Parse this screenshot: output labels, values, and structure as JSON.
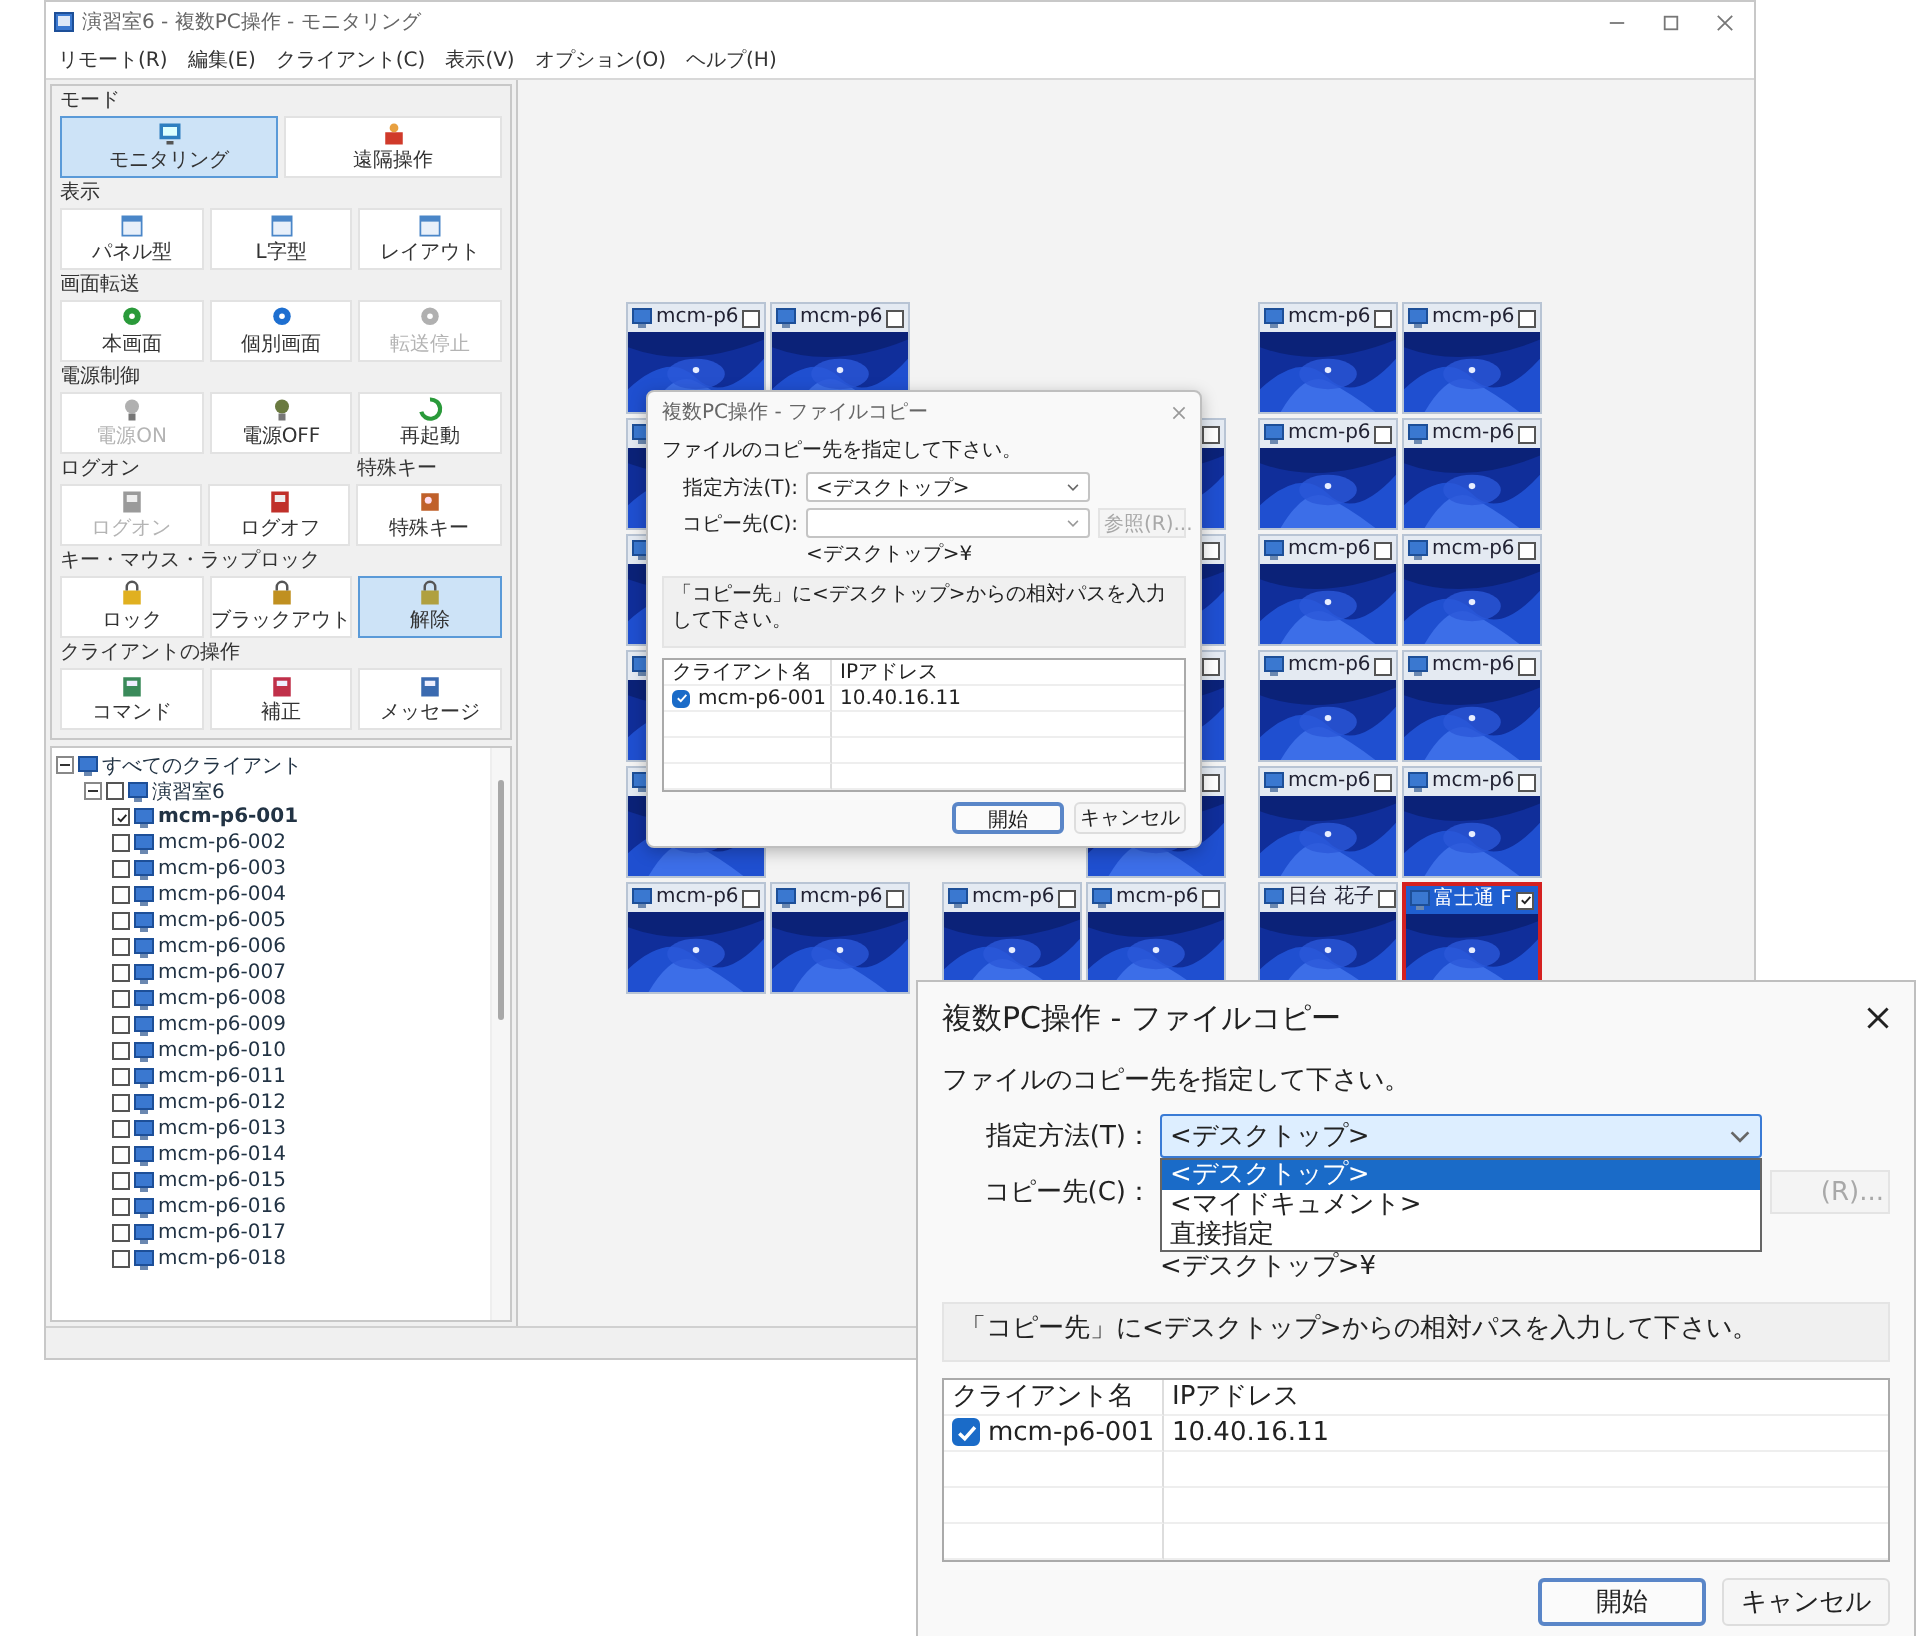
{
  "window": {
    "title": "演習室6 - 複数PC操作 - モニタリング"
  },
  "menu": [
    "リモート(R)",
    "編集(E)",
    "クライアント(C)",
    "表示(V)",
    "オプション(O)",
    "ヘルプ(H)"
  ],
  "toolbox": [
    {
      "groups": [
        {
          "title": "モード",
          "buttons": [
            {
              "label": "モニタリング",
              "kind": "monitor",
              "color": "#2f7fc0",
              "selected": true,
              "disabled": false
            },
            {
              "label": "遠隔操作",
              "kind": "person",
              "color": "#d03a2a",
              "selected": false,
              "disabled": false
            }
          ]
        }
      ]
    },
    {
      "groups": [
        {
          "title": "表示",
          "buttons": [
            {
              "label": "パネル型",
              "kind": "window",
              "color": "#4a86c8",
              "selected": false,
              "disabled": false
            },
            {
              "label": "L字型",
              "kind": "window",
              "color": "#4a86c8",
              "selected": false,
              "disabled": false
            },
            {
              "label": "レイアウト",
              "kind": "window",
              "color": "#4a86c8",
              "selected": false,
              "disabled": false
            }
          ]
        }
      ]
    },
    {
      "groups": [
        {
          "title": "画面転送",
          "buttons": [
            {
              "label": "本画面",
              "kind": "dot",
              "color": "#2a9a3a",
              "selected": false,
              "disabled": false
            },
            {
              "label": "個別画面",
              "kind": "dot",
              "color": "#1e6fd0",
              "selected": false,
              "disabled": false
            },
            {
              "label": "転送停止",
              "kind": "dot",
              "color": "#b0b0b0",
              "selected": false,
              "disabled": true
            }
          ]
        }
      ]
    },
    {
      "groups": [
        {
          "title": "電源制御",
          "buttons": [
            {
              "label": "電源ON",
              "kind": "bulb",
              "color": "#b0b0b0",
              "selected": false,
              "disabled": true
            },
            {
              "label": "電源OFF",
              "kind": "bulb",
              "color": "#6a7a40",
              "selected": false,
              "disabled": false
            },
            {
              "label": "再起動",
              "kind": "cycle",
              "color": "#2a9a3a",
              "selected": false,
              "disabled": false
            }
          ]
        }
      ]
    },
    {
      "groups": [
        {
          "title": "ログオン",
          "buttons": [
            {
              "label": "ログオン",
              "kind": "user",
              "color": "#9a9a9a",
              "selected": false,
              "disabled": true
            },
            {
              "label": "ログオフ",
              "kind": "user",
              "color": "#c0302a",
              "selected": false,
              "disabled": false
            }
          ]
        },
        {
          "title": "特殊キー",
          "buttons": [
            {
              "label": "特殊キー",
              "kind": "key",
              "color": "#c0602a",
              "selected": false,
              "disabled": false
            }
          ]
        }
      ]
    },
    {
      "groups": [
        {
          "title": "キー・マウス・ラップロック",
          "buttons": [
            {
              "label": "ロック",
              "kind": "lock",
              "color": "#e0b020",
              "selected": false,
              "disabled": false
            },
            {
              "label": "ブラックアウト",
              "kind": "lock",
              "color": "#c09020",
              "selected": false,
              "disabled": false
            },
            {
              "label": "解除",
              "kind": "lock",
              "color": "#b0a040",
              "selected": true,
              "disabled": false
            }
          ]
        }
      ]
    },
    {
      "groups": [
        {
          "title": "クライアントの操作",
          "buttons": [
            {
              "label": "コマンド",
              "kind": "tool",
              "color": "#3a8a5a",
              "selected": false,
              "disabled": false
            },
            {
              "label": "補正",
              "kind": "tool",
              "color": "#c0304a",
              "selected": false,
              "disabled": false
            },
            {
              "label": "メッセージ",
              "kind": "tool",
              "color": "#3a6ab0",
              "selected": false,
              "disabled": false
            }
          ]
        }
      ]
    }
  ],
  "tree": {
    "label": "すべてのクライアント",
    "expanded": true,
    "children": [
      {
        "label": "演習室6",
        "expanded": true,
        "checked": false,
        "children": [
          {
            "label": "mcm-p6-001",
            "checked": true
          },
          {
            "label": "mcm-p6-002",
            "checked": false
          },
          {
            "label": "mcm-p6-003",
            "checked": false
          },
          {
            "label": "mcm-p6-004",
            "checked": false
          },
          {
            "label": "mcm-p6-005",
            "checked": false
          },
          {
            "label": "mcm-p6-006",
            "checked": false
          },
          {
            "label": "mcm-p6-007",
            "checked": false
          },
          {
            "label": "mcm-p6-008",
            "checked": false
          },
          {
            "label": "mcm-p6-009",
            "checked": false
          },
          {
            "label": "mcm-p6-010",
            "checked": false
          },
          {
            "label": "mcm-p6-011",
            "checked": false
          },
          {
            "label": "mcm-p6-012",
            "checked": false
          },
          {
            "label": "mcm-p6-013",
            "checked": false
          },
          {
            "label": "mcm-p6-014",
            "checked": false
          },
          {
            "label": "mcm-p6-015",
            "checked": false
          },
          {
            "label": "mcm-p6-016",
            "checked": false
          },
          {
            "label": "mcm-p6-017",
            "checked": false
          },
          {
            "label": "mcm-p6-018",
            "checked": false
          }
        ]
      }
    ]
  },
  "thumbnails": {
    "rows": [
      [
        {
          "label": "mcm-p6",
          "checked": false,
          "selected": false
        },
        {
          "label": "mcm-p6",
          "checked": false,
          "selected": false
        },
        null,
        null,
        {
          "label": "mcm-p6",
          "checked": false,
          "selected": false
        },
        {
          "label": "mcm-p6",
          "checked": false,
          "selected": false
        }
      ],
      [
        {
          "selected": false
        },
        null,
        null,
        {
          "checked": false,
          "selected": false
        },
        {
          "label": "mcm-p6",
          "checked": false,
          "selected": false
        },
        {
          "label": "mcm-p6",
          "checked": false,
          "selected": false
        }
      ],
      [
        {
          "selected": false
        },
        null,
        null,
        {
          "checked": false,
          "selected": false
        },
        {
          "label": "mcm-p6",
          "checked": false,
          "selected": false
        },
        {
          "label": "mcm-p6",
          "checked": false,
          "selected": false
        }
      ],
      [
        {
          "selected": false
        },
        null,
        null,
        {
          "checked": false,
          "selected": false
        },
        {
          "label": "mcm-p6",
          "checked": false,
          "selected": false
        },
        {
          "label": "mcm-p6",
          "checked": false,
          "selected": false
        }
      ],
      [
        {
          "selected": false
        },
        null,
        null,
        {
          "checked": false,
          "selected": false
        },
        {
          "label": "mcm-p6",
          "checked": false,
          "selected": false
        },
        {
          "label": "mcm-p6",
          "checked": false,
          "selected": false
        }
      ],
      [
        {
          "label": "mcm-p6",
          "checked": false,
          "selected": false
        },
        {
          "label": "mcm-p6",
          "checked": false,
          "selected": false
        },
        {
          "label": "mcm-p6",
          "checked": false,
          "selected": false
        },
        {
          "label": "mcm-p6",
          "checked": false,
          "selected": false
        },
        {
          "label": "日台 花子",
          "checked": false,
          "selected": false
        },
        {
          "label": "富士通 F",
          "checked": true,
          "selected": true
        }
      ]
    ]
  },
  "dialog": {
    "title": "複数PC操作 - ファイルコピー",
    "instruction": "ファイルのコピー先を指定して下さい。",
    "method": {
      "label": "指定方法(T):",
      "value": "<デスクトップ>",
      "expanded": false
    },
    "destination": {
      "label": "コピー先(C):"
    },
    "browse": {
      "label": "参照(R)...",
      "disabled": true
    },
    "hint": "<デスクトップ>¥",
    "note": "「コピー先」に<デスクトップ>からの相対パスを入力して下さい。",
    "list": {
      "columns": [
        "クライアント名",
        "IPアドレス"
      ],
      "rows": [
        {
          "checked": true,
          "cells": [
            "mcm-p6-001",
            "10.40.16.11"
          ]
        }
      ]
    },
    "buttons": [
      {
        "label": "開始",
        "default": true
      },
      {
        "label": "キャンセル",
        "default": false
      }
    ]
  },
  "callout": {
    "title": "複数PC操作 - ファイルコピー",
    "instruction": "ファイルのコピー先を指定して下さい。",
    "method": {
      "label": "指定方法(T)：",
      "value": "<デスクトップ>",
      "expanded": true,
      "options": [
        {
          "label": "<デスクトップ>",
          "selected": true
        },
        {
          "label": "<マイドキュメント>",
          "selected": false
        },
        {
          "label": "直接指定",
          "selected": false
        }
      ]
    },
    "destination": {
      "label": "コピー先(C)："
    },
    "browse": {
      "label": "(R)...",
      "disabled": true
    },
    "hint": "<デスクトップ>¥",
    "note": "「コピー先」に<デスクトップ>からの相対パスを入力して下さい。",
    "list": {
      "columns": [
        "クライアント名",
        "IPアドレス"
      ],
      "rows": [
        {
          "checked": true,
          "cells": [
            "mcm-p6-001",
            "10.40.16.11"
          ]
        }
      ]
    },
    "buttons": [
      {
        "label": "開始",
        "default": true
      },
      {
        "label": "キャンセル",
        "default": false
      }
    ]
  }
}
